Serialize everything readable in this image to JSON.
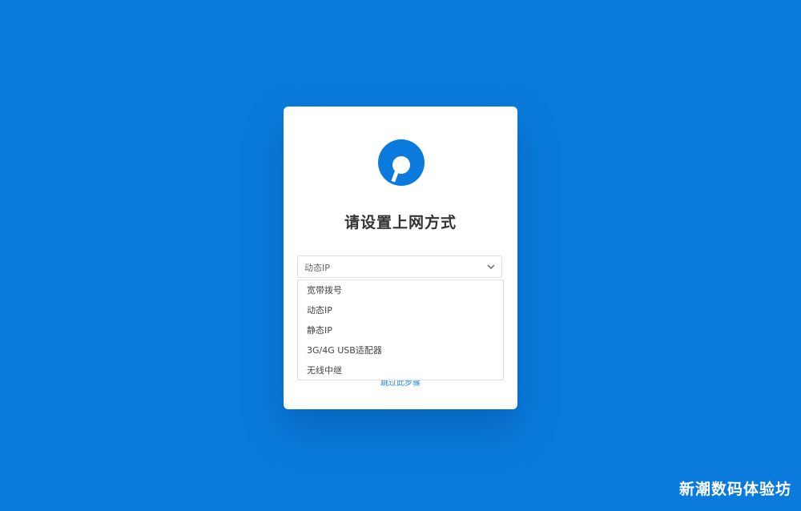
{
  "setup": {
    "title": "请设置上网方式",
    "select": {
      "current": "动态IP",
      "options": [
        "宽带拨号",
        "动态IP",
        "静态IP",
        "3G/4G USB适配器",
        "无线中继"
      ]
    },
    "hidden_link": "跳过此步骤"
  },
  "watermark": "新潮数码体验坊",
  "colors": {
    "background": "#0a7bdc",
    "brand": "#0a7bdc",
    "card": "#ffffff"
  }
}
